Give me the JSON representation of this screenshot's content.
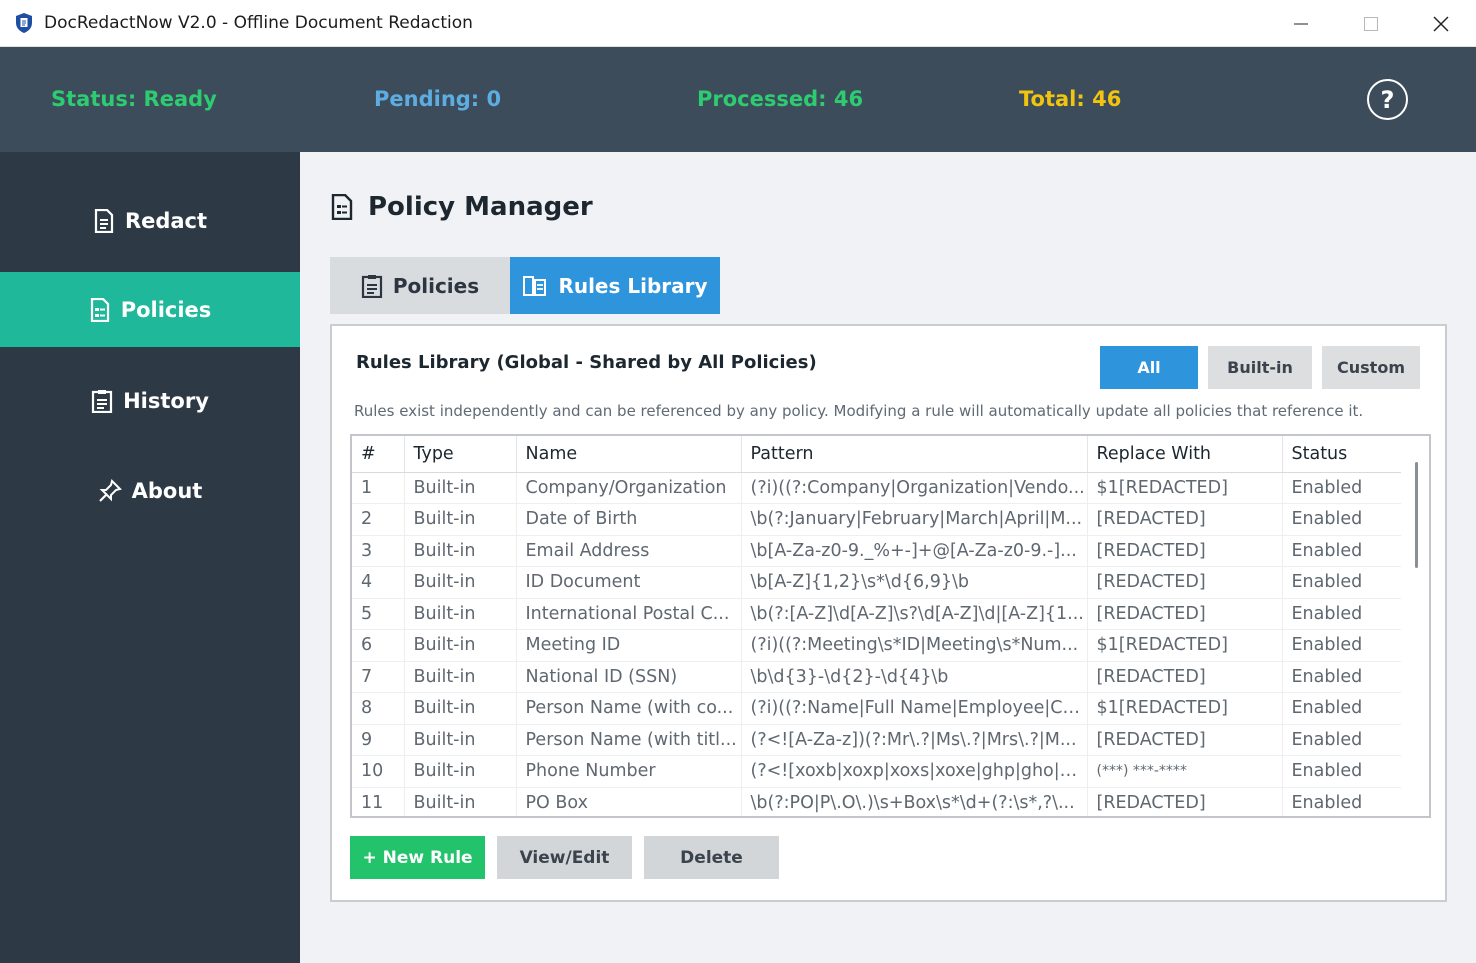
{
  "window": {
    "title": "DocRedactNow V2.0 - Offline Document Redaction"
  },
  "status": {
    "status_label": "Status: Ready",
    "pending_label": "Pending: 0",
    "processed_label": "Processed: 46",
    "total_label": "Total: 46",
    "help": "?",
    "colors": {
      "status": "#2ecc71",
      "pending": "#5dade2",
      "processed": "#2ecc71",
      "total": "#f1c40f"
    }
  },
  "sidebar": {
    "items": [
      {
        "label": "Redact",
        "icon": "document-icon"
      },
      {
        "label": "Policies",
        "icon": "policy-icon",
        "active": true
      },
      {
        "label": "History",
        "icon": "history-icon"
      },
      {
        "label": "About",
        "icon": "pin-icon"
      }
    ]
  },
  "main": {
    "title": "Policy Manager",
    "tabs": [
      {
        "label": "Policies",
        "icon": "clipboard-icon"
      },
      {
        "label": "Rules Library",
        "icon": "books-icon",
        "active": true
      }
    ],
    "panel": {
      "title": "Rules Library (Global - Shared by All Policies)",
      "filters": [
        "All",
        "Built-in",
        "Custom"
      ],
      "active_filter": "All",
      "description": "Rules exist independently and can be referenced by any policy. Modifying a rule will automatically update all policies that reference it.",
      "table": {
        "columns": [
          "#",
          "Type",
          "Name",
          "Pattern",
          "Replace With",
          "Status"
        ],
        "rows": [
          [
            "1",
            "Built-in",
            "Company/Organization",
            "(?i)((?:Company|Organization|Vendo...",
            "$1[REDACTED]",
            "Enabled"
          ],
          [
            "2",
            "Built-in",
            "Date of Birth",
            "\\b(?:January|February|March|April|M...",
            "[REDACTED]",
            "Enabled"
          ],
          [
            "3",
            "Built-in",
            "Email Address",
            "\\b[A-Za-z0-9._%+-]+@[A-Za-z0-9.-]...",
            "[REDACTED]",
            "Enabled"
          ],
          [
            "4",
            "Built-in",
            "ID Document",
            "\\b[A-Z]{1,2}\\s*\\d{6,9}\\b",
            "[REDACTED]",
            "Enabled"
          ],
          [
            "5",
            "Built-in",
            "International Postal C...",
            "\\b(?:[A-Z]\\d[A-Z]\\s?\\d[A-Z]\\d|[A-Z]{1...",
            "[REDACTED]",
            "Enabled"
          ],
          [
            "6",
            "Built-in",
            "Meeting ID",
            "(?i)((?:Meeting\\s*ID|Meeting\\s*Num...",
            "$1[REDACTED]",
            "Enabled"
          ],
          [
            "7",
            "Built-in",
            "National ID (SSN)",
            "\\b\\d{3}-\\d{2}-\\d{4}\\b",
            "[REDACTED]",
            "Enabled"
          ],
          [
            "8",
            "Built-in",
            "Person Name (with co...",
            "(?i)((?:Name|Full Name|Employee|Co...",
            "$1[REDACTED]",
            "Enabled"
          ],
          [
            "9",
            "Built-in",
            "Person Name (with titl...",
            "(?<![A-Za-z])(?:Mr\\.?|Ms\\.?|Mrs\\.?|M...",
            "[REDACTED]",
            "Enabled"
          ],
          [
            "10",
            "Built-in",
            "Phone Number",
            "(?<![xoxb|xoxp|xoxs|xoxe|ghp|gho|g...",
            "(***) ***-****",
            "Enabled"
          ],
          [
            "11",
            "Built-in",
            "PO Box",
            "\\b(?:PO|P\\.O\\.)\\s+Box\\s*\\d+(?:\\s*,?\\...",
            "[REDACTED]",
            "Enabled"
          ]
        ]
      },
      "actions": {
        "new": "+ New Rule",
        "view": "View/Edit",
        "delete": "Delete"
      }
    }
  }
}
